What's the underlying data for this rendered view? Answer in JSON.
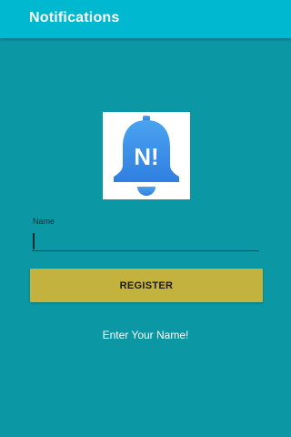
{
  "app_bar": {
    "title": "Notifications",
    "color": "#00b9d1"
  },
  "logo": {
    "icon": "notification-bell-icon",
    "badge_text": "N!",
    "color": "#3d8fe8"
  },
  "form": {
    "name_label": "Name",
    "name_value": "",
    "register_label": "REGISTER",
    "register_color": "#c3b23e",
    "hint": "Enter Your Name!"
  },
  "background_color": "#0b97a4"
}
